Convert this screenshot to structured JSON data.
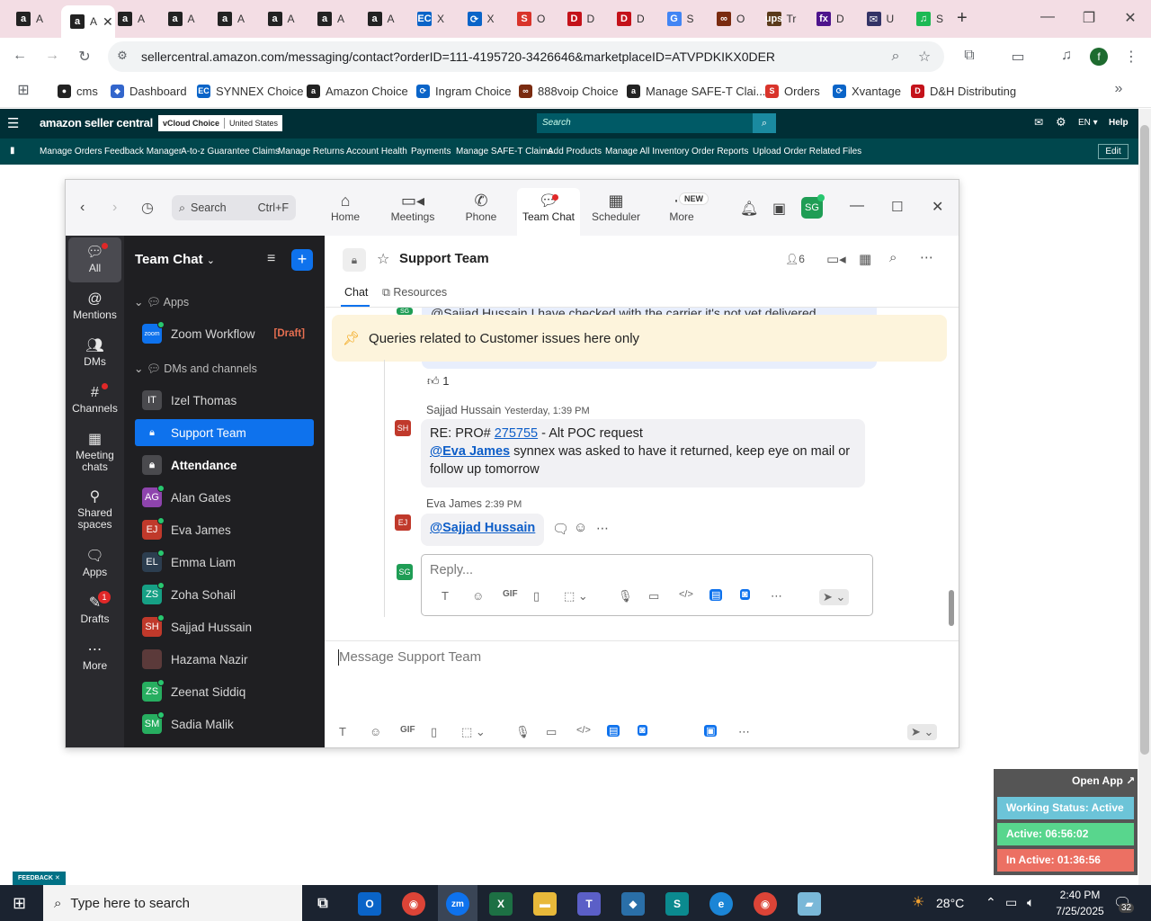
{
  "browser": {
    "tabs": [
      {
        "label": "A",
        "icon": "amazon"
      },
      {
        "label": "A",
        "icon": "amazon",
        "active": true
      },
      {
        "label": "A",
        "icon": "amazon"
      },
      {
        "label": "A",
        "icon": "amazon"
      },
      {
        "label": "A",
        "icon": "amazon"
      },
      {
        "label": "A",
        "icon": "amazon"
      },
      {
        "label": "A",
        "icon": "amazon"
      },
      {
        "label": "A",
        "icon": "amazon"
      },
      {
        "label": "X",
        "icon": "synnex"
      },
      {
        "label": "X",
        "icon": "ingram"
      },
      {
        "label": "O",
        "icon": "orders"
      },
      {
        "label": "D",
        "icon": "dh"
      },
      {
        "label": "D",
        "icon": "dh"
      },
      {
        "label": "S",
        "icon": "google"
      },
      {
        "label": "O",
        "icon": "888"
      },
      {
        "label": "Tr",
        "icon": "ups"
      },
      {
        "label": "D",
        "icon": "fedex"
      },
      {
        "label": "U",
        "icon": "usps"
      },
      {
        "label": "S",
        "icon": "spotify"
      }
    ],
    "url": "sellercentral.amazon.com/messaging/contact?orderID=111-4195720-3426646&marketplaceID=ATVPDKIKX0DER",
    "profile_initial": "f",
    "bookmarks": [
      "cms",
      "Dashboard",
      "SYNNEX Choice",
      "Amazon Choice",
      "Ingram Choice",
      "888voip Choice",
      "Manage SAFE-T Clai...",
      "Orders",
      "Xvantage",
      "D&H Distributing"
    ]
  },
  "seller_central": {
    "logo": "amazon seller central",
    "account": "vCloud Choice",
    "region": "United States",
    "search_placeholder": "Search",
    "lang": "EN",
    "help": "Help",
    "nav": [
      "Manage Orders",
      "Feedback Manager",
      "A-to-z Guarantee Claims",
      "Manage Returns",
      "Account Health",
      "Payments",
      "Manage SAFE-T Claims",
      "Add Products",
      "Manage All Inventory",
      "Order Reports",
      "Upload Order Related Files"
    ],
    "edit": "Edit",
    "feedback": "FEEDBACK"
  },
  "zoom": {
    "search_label": "Search",
    "search_shortcut": "Ctrl+F",
    "top_nav": [
      "Home",
      "Meetings",
      "Phone",
      "Team Chat",
      "Scheduler",
      "More"
    ],
    "new_badge": "NEW",
    "profile_initials": "SG",
    "rail": [
      "All",
      "Mentions",
      "DMs",
      "Channels",
      "Meeting chats",
      "Shared spaces",
      "Apps",
      "Drafts",
      "More"
    ],
    "drafts_badge": "1",
    "list_title": "Team Chat",
    "sections": {
      "apps": "Apps",
      "dms": "DMs and channels"
    },
    "apps": [
      {
        "name": "Zoom Workflow",
        "tag": "[Draft]"
      }
    ],
    "channels": [
      {
        "name": "Izel Thomas",
        "initials": "IT",
        "color": "#4a4a4e"
      },
      {
        "name": "Support Team",
        "initials": "",
        "color": "#0e72ed",
        "selected": true
      },
      {
        "name": "Attendance",
        "initials": "",
        "color": "#4a4a4e",
        "bold": true
      },
      {
        "name": "Alan Gates",
        "initials": "AG",
        "color": "#8e44ad"
      },
      {
        "name": "Eva James",
        "initials": "EJ",
        "color": "#c0392b"
      },
      {
        "name": "Emma Liam",
        "initials": "EL",
        "color": "#2c3e50"
      },
      {
        "name": "Zoha Sohail",
        "initials": "ZS",
        "color": "#16a085"
      },
      {
        "name": "Sajjad Hussain",
        "initials": "SH",
        "color": "#c0392b"
      },
      {
        "name": "Hazama Nazir",
        "initials": "",
        "color": "#5b3a3a"
      },
      {
        "name": "Zeenat Siddiq",
        "initials": "ZS",
        "color": "#27ae60"
      },
      {
        "name": "Sadia Malik",
        "initials": "SM",
        "color": "#27ae60"
      }
    ],
    "channel": {
      "name": "Support Team",
      "member_count": "6",
      "tabs": [
        "Chat",
        "Resources"
      ],
      "pinned": "Queries related to Customer issues here only",
      "prev_partial": "@Sajjad Hussain I have checked with the carrier it's not yet delivered",
      "reaction_count": "1",
      "messages": [
        {
          "author": "Sajjad Hussain",
          "time": "Yesterday, 1:39 PM",
          "initials": "SH",
          "line1_prefix": "RE: PRO# ",
          "line1_link": "275755",
          "line1_suffix": " - Alt POC request",
          "mention": "@Eva James",
          "text": " synnex was asked to have it returned, keep eye on mail or follow up tomorrow"
        },
        {
          "author": "Eva James",
          "time": "2:39 PM",
          "initials": "EJ",
          "mention": "@Sajjad Hussain"
        }
      ],
      "reply_placeholder": "Reply...",
      "reply_avatar": "SG",
      "compose_placeholder": "Message Support Team"
    }
  },
  "widget": {
    "open_app": "Open App ↗",
    "status": "Working Status: Active",
    "active": "Active: 06:56:02",
    "inactive": "In Active: 01:36:56"
  },
  "taskbar": {
    "search_placeholder": "Type here to search",
    "temp": "28°C",
    "time": "2:40 PM",
    "date": "7/25/2025",
    "notif_count": "32"
  }
}
